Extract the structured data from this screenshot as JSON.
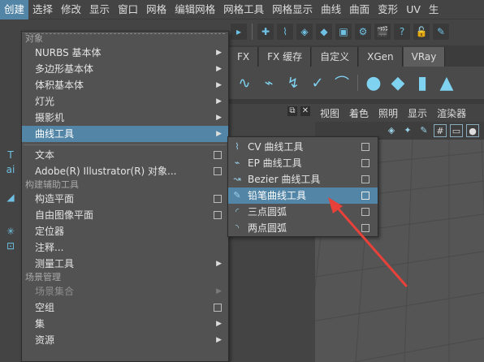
{
  "menubar": {
    "items": [
      "创建",
      "选择",
      "修改",
      "显示",
      "窗口",
      "网格",
      "编辑网格",
      "网格工具",
      "网格显示",
      "曲线",
      "曲面",
      "变形",
      "UV",
      "生"
    ]
  },
  "shelf_tabs": [
    "FX",
    "FX 缓存",
    "自定义",
    "XGen",
    "VRay"
  ],
  "viewport_menu": [
    "视图",
    "着色",
    "照明",
    "显示",
    "渲染器"
  ],
  "create_menu": {
    "section_objects": "对象",
    "nurbs": "NURBS 基本体",
    "polygon": "多边形基本体",
    "volume": "体积基本体",
    "lights": "灯光",
    "cameras": "摄影机",
    "curve_tools": "曲线工具",
    "text": "文本",
    "illustrator": "Adobe(R) Illustrator(R) 对象...",
    "section_construction": "构建辅助工具",
    "construction_plane": "构造平面",
    "free_image_plane": "自由图像平面",
    "locator": "定位器",
    "annotation": "注释...",
    "measure_tools": "测量工具",
    "section_scene": "场景管理",
    "scene_assembly": "场景集合",
    "empty_group": "空组",
    "sets": "集",
    "assets": "资源"
  },
  "curve_tools_menu": {
    "items": [
      {
        "label": "CV 曲线工具",
        "icon": "cv-curve-icon"
      },
      {
        "label": "EP 曲线工具",
        "icon": "ep-curve-icon"
      },
      {
        "label": "Bezier 曲线工具",
        "icon": "bezier-curve-icon"
      },
      {
        "label": "铅笔曲线工具",
        "icon": "pencil-curve-icon"
      },
      {
        "label": "三点圆弧",
        "icon": "three-point-arc-icon"
      },
      {
        "label": "两点圆弧",
        "icon": "two-point-arc-icon"
      }
    ],
    "highlighted": "铅笔曲线工具"
  },
  "colors": {
    "highlight": "#5285a6",
    "menu_bg": "#525252",
    "annotation_arrow": "#e8413a"
  }
}
